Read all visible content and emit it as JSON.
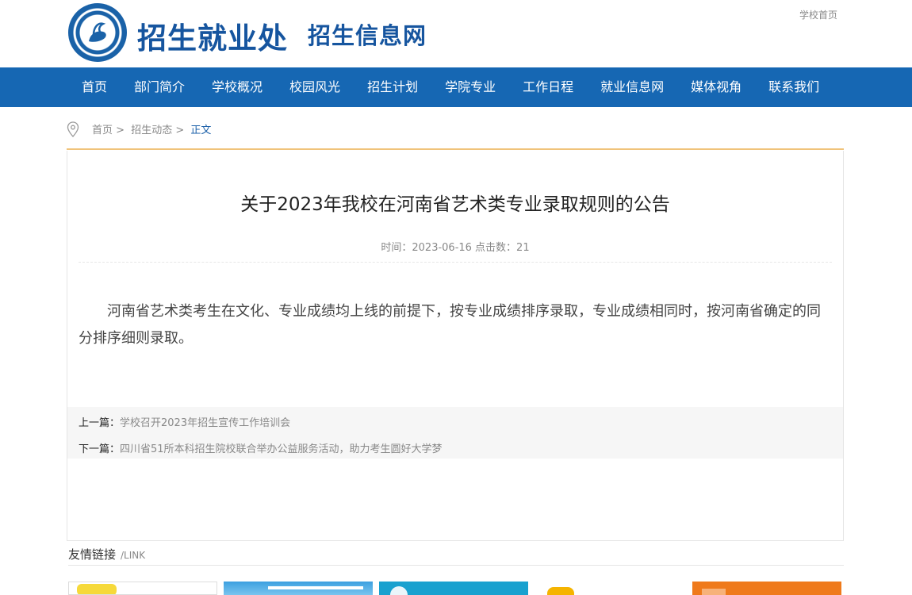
{
  "header": {
    "title": "招生就业处",
    "subtitle": "招生信息网",
    "home_link": "学校首页"
  },
  "nav": [
    "首页",
    "部门简介",
    "学校概况",
    "校园风光",
    "招生计划",
    "学院专业",
    "工作日程",
    "就业信息网",
    "媒体视角",
    "联系我们"
  ],
  "breadcrumb": {
    "home": "首页",
    "section": "招生动态",
    "current": "正文",
    "sep": ">"
  },
  "article": {
    "title": "关于2023年我校在河南省艺术类专业录取规则的公告",
    "meta": "时间：2023-06-16 点击数：21",
    "body": "河南省艺术类考生在文化、专业成绩均上线的前提下，按专业成绩排序录取，专业成绩相同时，按河南省确定的同分排序细则录取。"
  },
  "prevnext": {
    "prev_label": "上一篇：",
    "prev_title": "学校召开2023年招生宣传工作培训会",
    "next_label": "下一篇：",
    "next_title": "四川省51所本科招生院校联合举办公益服务活动，助力考生圆好大学梦"
  },
  "links": {
    "title": "友情链接",
    "sub": "/LINK"
  },
  "colors": {
    "brand": "#16559f",
    "nav_bg": "#1667b3",
    "accent_line": "#f0c37a"
  }
}
